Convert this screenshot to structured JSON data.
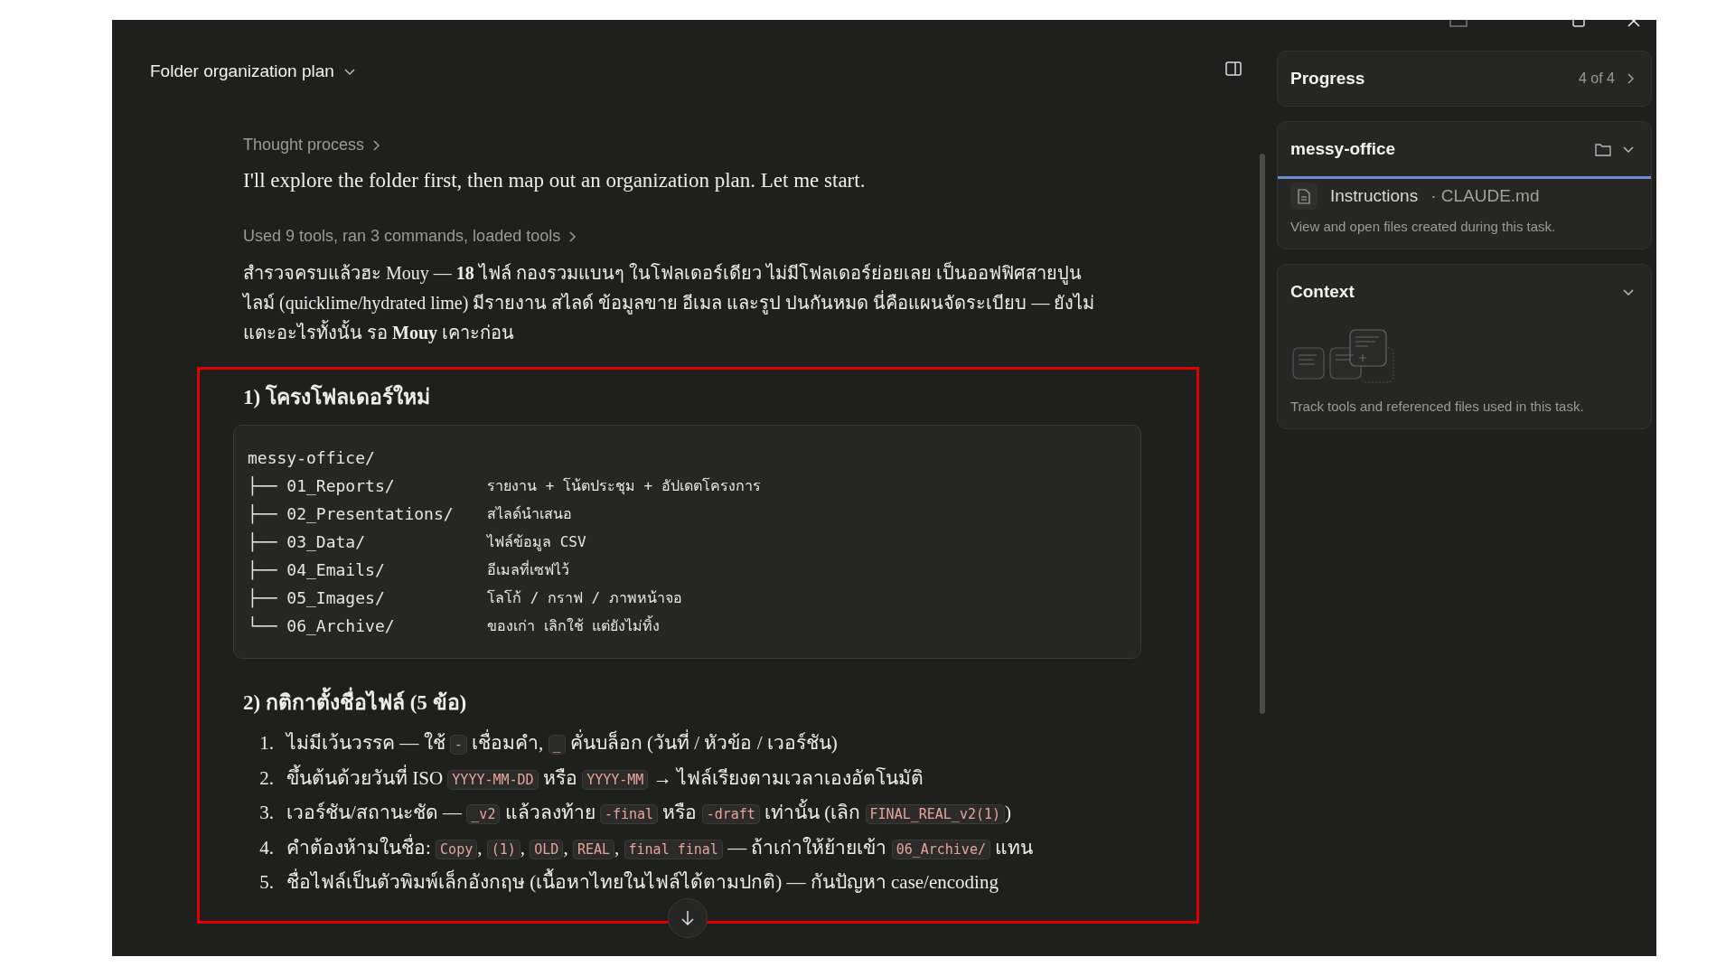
{
  "header": {
    "title": "Folder organization plan"
  },
  "chat": {
    "thought_label": "Thought process",
    "intro": "I'll explore the folder first, then map out an organization plan. Let me start.",
    "tools_label": "Used 9 tools, ran 3 commands, loaded tools",
    "summary": "สำรวจครบแล้วฮะ Mouy — **18** ไฟล์ กองรวมแบนๆ ในโฟลเดอร์เดียว ไม่มีโฟลเดอร์ย่อยเลย เป็นออฟฟิศสายปูนไลม์ (quicklime/hydrated lime) มีรายงาน สไลด์ ข้อมูลขาย อีเมล และรูป ปนกันหมด นี่คือแผนจัดระเบียบ — ยังไม่แตะอะไรทั้งนั้น รอ **Mouy** เคาะก่อน"
  },
  "sections": [
    {
      "kind": "tree",
      "heading": "1) โครงโฟลเดอร์ใหม่",
      "root": "messy-office/",
      "rows": [
        {
          "name": "├── 01_Reports/",
          "note": "รายงาน + โน้ตประชุม + อัปเดตโครงการ"
        },
        {
          "name": "├── 02_Presentations/",
          "note": "สไลด์นำเสนอ"
        },
        {
          "name": "├── 03_Data/",
          "note": "ไฟล์ข้อมูล CSV"
        },
        {
          "name": "├── 04_Emails/",
          "note": "อีเมลที่เซฟไว้"
        },
        {
          "name": "├── 05_Images/",
          "note": "โลโก้ / กราฟ / ภาพหน้าจอ"
        },
        {
          "name": "└── 06_Archive/",
          "note": "ของเก่า เลิกใช้ แต่ยังไม่ทิ้ง"
        }
      ]
    },
    {
      "kind": "list",
      "heading": "2) กติกาตั้งชื่อไฟล์ (5 ข้อ)",
      "items": [
        {
          "number": "1.",
          "parts": [
            {
              "kind": "text",
              "text": "ไม่มีเว้นวรรค — ใช้ "
            },
            {
              "kind": "code",
              "text": "-"
            },
            {
              "kind": "text",
              "text": " เชื่อมคำ, "
            },
            {
              "kind": "code",
              "text": "_"
            },
            {
              "kind": "text",
              "text": " คั่นบล็อก (วันที่ / หัวข้อ / เวอร์ชัน)"
            }
          ]
        },
        {
          "number": "2.",
          "parts": [
            {
              "kind": "text",
              "text": "ขึ้นต้นด้วยวันที่ ISO "
            },
            {
              "kind": "code",
              "text": "YYYY-MM-DD"
            },
            {
              "kind": "text",
              "text": " หรือ "
            },
            {
              "kind": "code",
              "text": "YYYY-MM"
            },
            {
              "kind": "text",
              "text": " → ไฟล์เรียงตามเวลาเองอัตโนมัติ"
            }
          ]
        },
        {
          "number": "3.",
          "parts": [
            {
              "kind": "text",
              "text": "เวอร์ชัน/สถานะชัด — "
            },
            {
              "kind": "code",
              "text": "_v2"
            },
            {
              "kind": "text",
              "text": " แล้วลงท้าย "
            },
            {
              "kind": "code",
              "text": "-final"
            },
            {
              "kind": "text",
              "text": " หรือ "
            },
            {
              "kind": "code",
              "text": "-draft"
            },
            {
              "kind": "text",
              "text": " เท่านั้น (เลิก "
            },
            {
              "kind": "code",
              "text": "FINAL_REAL_v2(1)"
            },
            {
              "kind": "text",
              "text": ")"
            }
          ]
        },
        {
          "number": "4.",
          "parts": [
            {
              "kind": "text",
              "text": "คำต้องห้ามในชื่อ: "
            },
            {
              "kind": "code",
              "text": "Copy"
            },
            {
              "kind": "text",
              "text": ", "
            },
            {
              "kind": "code",
              "text": "(1)"
            },
            {
              "kind": "text",
              "text": ", "
            },
            {
              "kind": "code",
              "text": "OLD"
            },
            {
              "kind": "text",
              "text": ", "
            },
            {
              "kind": "code",
              "text": "REAL"
            },
            {
              "kind": "text",
              "text": ", "
            },
            {
              "kind": "code",
              "text": "final final"
            },
            {
              "kind": "text",
              "text": " — ถ้าเก่าให้ย้ายเข้า "
            },
            {
              "kind": "code",
              "text": "06_Archive/"
            },
            {
              "kind": "text",
              "text": " แทน"
            }
          ]
        },
        {
          "number": "5.",
          "parts": [
            {
              "kind": "text",
              "text": "ชื่อไฟล์เป็นตัวพิมพ์เล็กอังกฤษ (เนื้อหาไทยในไฟล์ได้ตามปกติ) — กันปัญหา case/encoding"
            }
          ]
        }
      ]
    }
  ],
  "side_panel": {
    "progress": {
      "title": "Progress",
      "count": "4 of 4"
    },
    "folder": {
      "title": "messy-office",
      "files": [
        {
          "label": "Instructions",
          "detail": "· CLAUDE.md"
        }
      ],
      "hint": "View and open files created during this task."
    },
    "context": {
      "title": "Context",
      "hint": "Track tools and referenced files used in this task."
    }
  }
}
